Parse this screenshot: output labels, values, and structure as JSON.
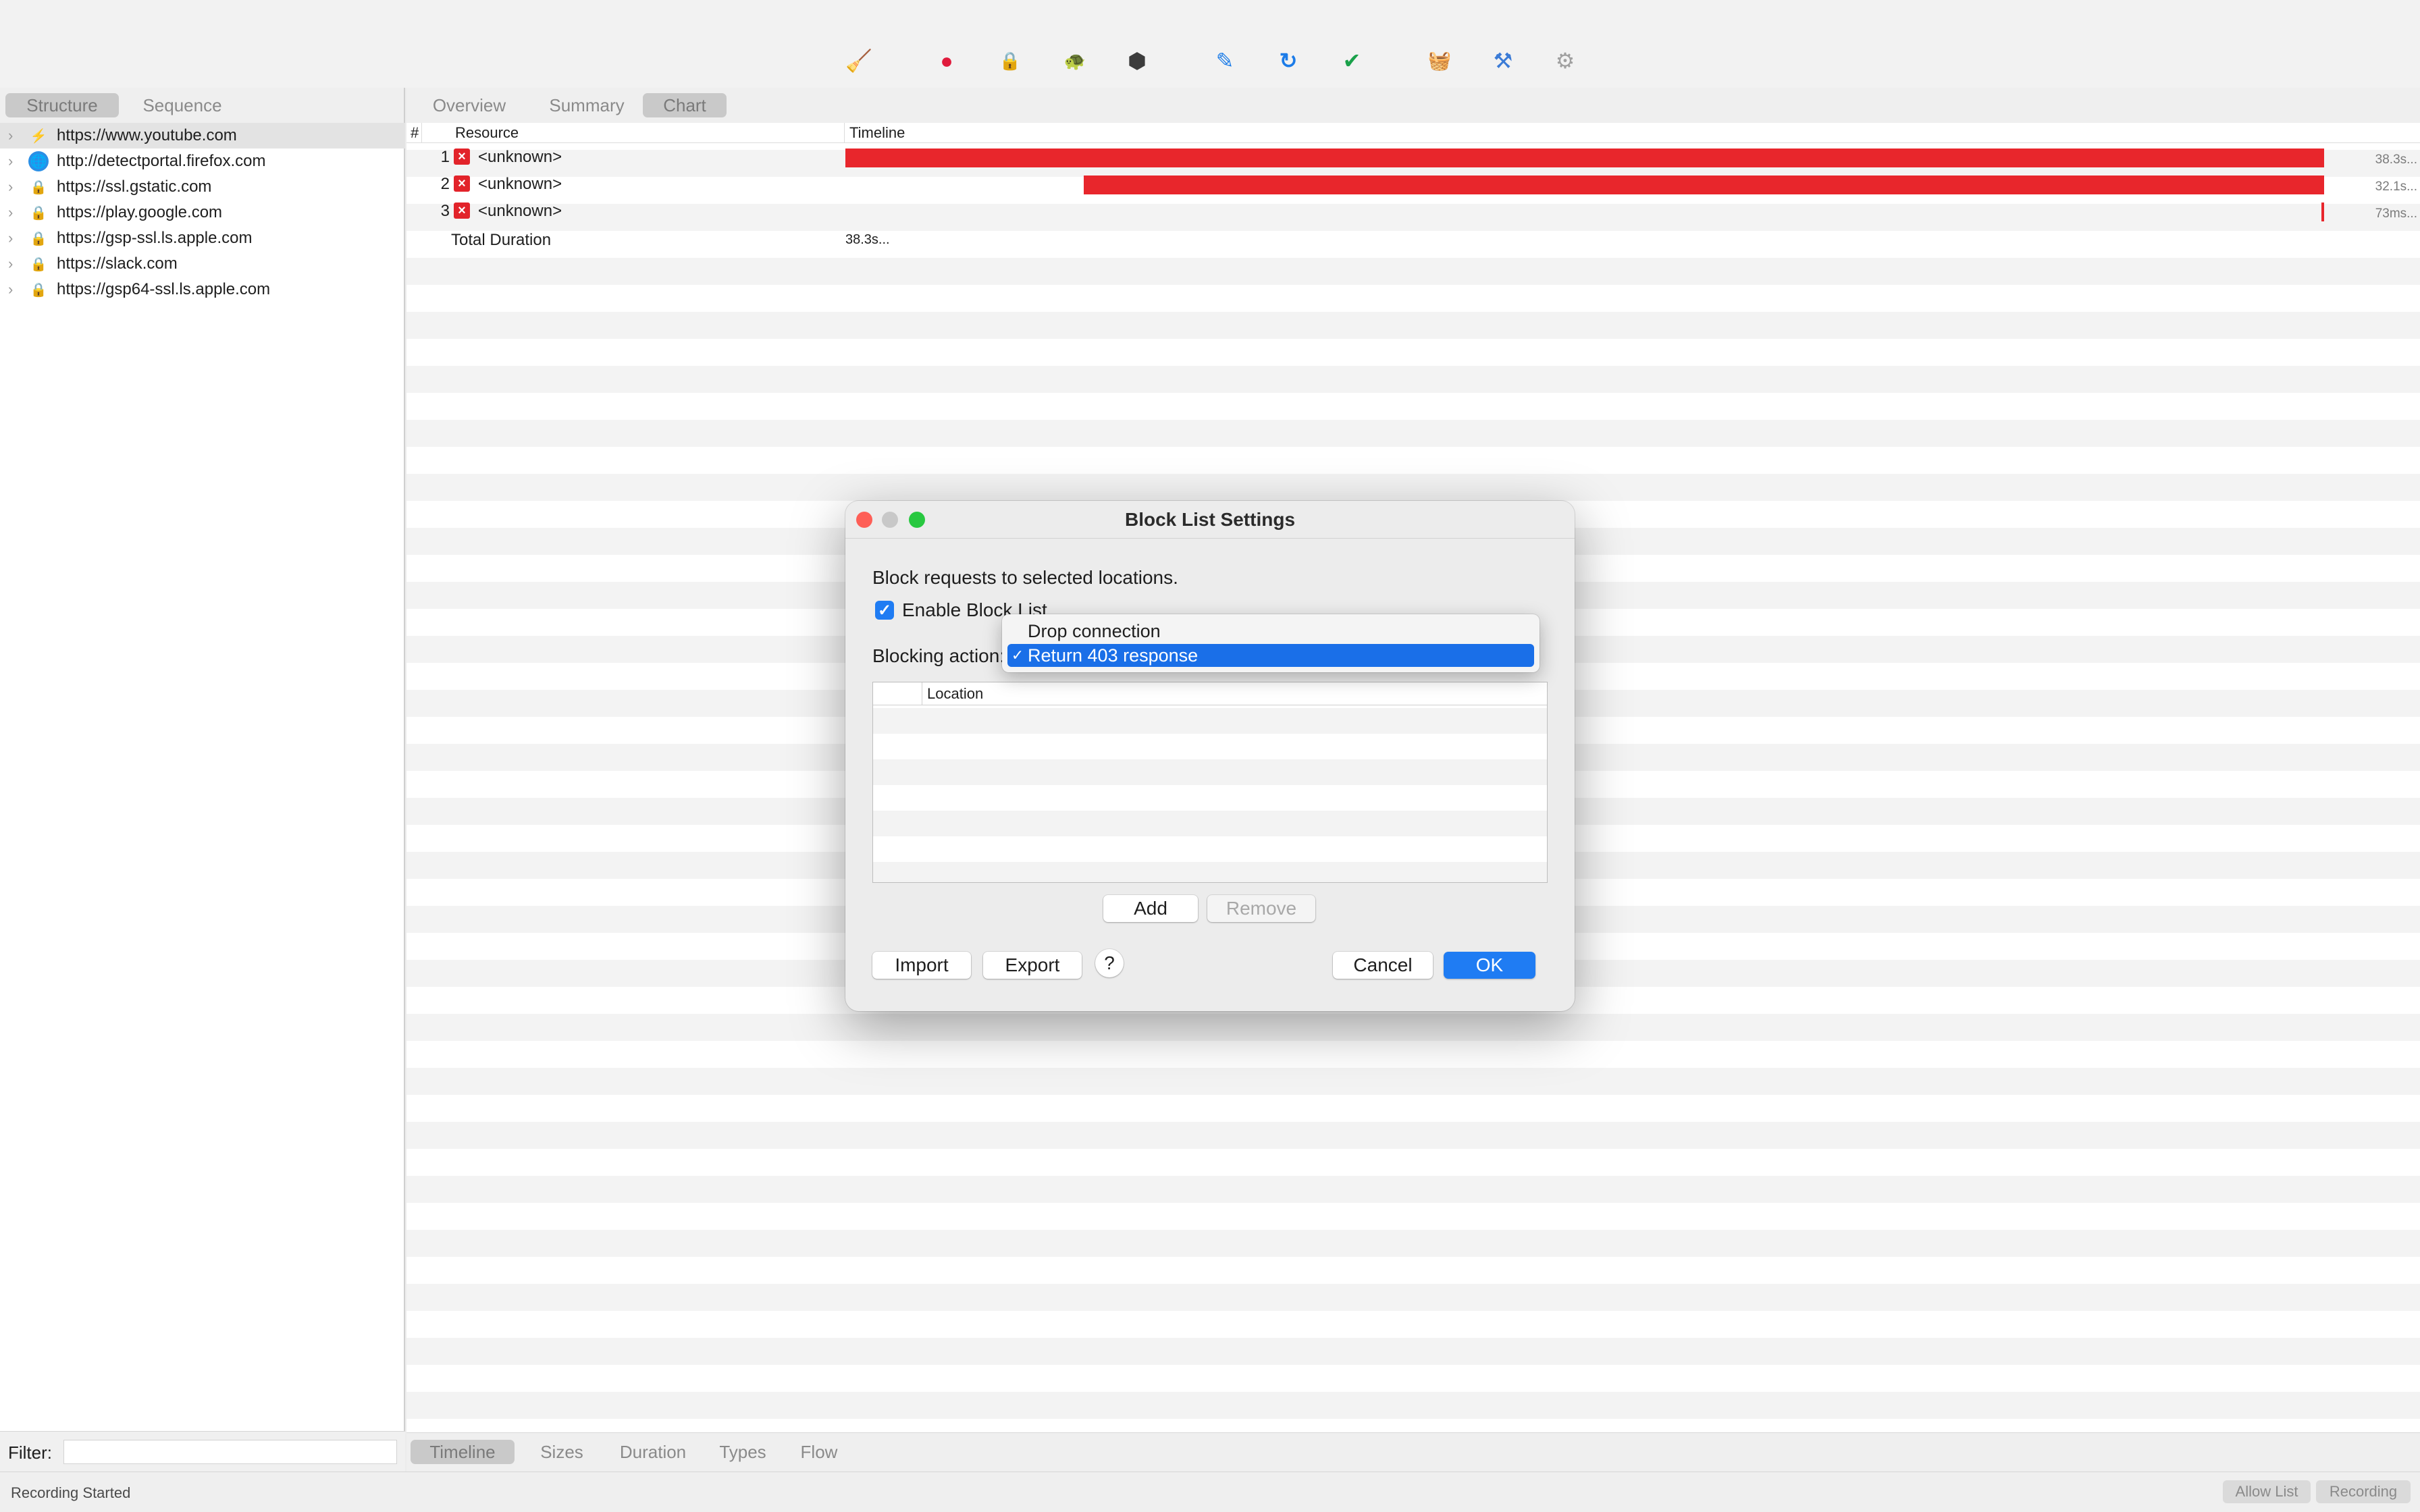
{
  "toolbar": {
    "icons": [
      {
        "name": "broom-icon",
        "glyph": "🧹",
        "color": "#e6a817"
      },
      {
        "name": "record-icon",
        "glyph": "●",
        "color": "#e01b3c"
      },
      {
        "name": "ssl-lock-icon",
        "glyph": "🔒",
        "color": "#888888"
      },
      {
        "name": "turtle-icon",
        "glyph": "🐢",
        "color": "#555555"
      },
      {
        "name": "stop-hexagon-icon",
        "glyph": "⬢",
        "color": "#3c3c3c"
      },
      {
        "name": "pen-icon",
        "glyph": "✎",
        "color": "#1c7ce8"
      },
      {
        "name": "refresh-icon",
        "glyph": "↻",
        "color": "#1c7ce8"
      },
      {
        "name": "checkmark-icon",
        "glyph": "✔",
        "color": "#1aa14a"
      },
      {
        "name": "basket-icon",
        "glyph": "🧺",
        "color": "#1aa14a"
      },
      {
        "name": "tools-icon",
        "glyph": "⚒",
        "color": "#3b7bd6"
      },
      {
        "name": "gear-icon",
        "glyph": "⚙",
        "color": "#a0a0a0"
      }
    ]
  },
  "left": {
    "tabs": [
      "Structure",
      "Sequence"
    ],
    "hosts": [
      {
        "url": "https://www.youtube.com",
        "icon": "lightning-icon"
      },
      {
        "url": "http://detectportal.firefox.com",
        "icon": "globe-icon"
      },
      {
        "url": "https://ssl.gstatic.com",
        "icon": "lock-icon"
      },
      {
        "url": "https://play.google.com",
        "icon": "lock-icon"
      },
      {
        "url": "https://gsp-ssl.ls.apple.com",
        "icon": "lock-icon"
      },
      {
        "url": "https://slack.com",
        "icon": "lock-icon"
      },
      {
        "url": "https://gsp64-ssl.ls.apple.com",
        "icon": "lock-icon"
      }
    ],
    "filter_label": "Filter:"
  },
  "right": {
    "tabs": [
      "Overview",
      "Summary",
      "Chart"
    ],
    "columns": {
      "num": "#",
      "resource": "Resource",
      "timeline": "Timeline"
    },
    "rows": [
      {
        "num": "1",
        "resource": "<unknown>",
        "duration": "38.3s...",
        "start_frac": 0.0,
        "end_frac": 1.0
      },
      {
        "num": "2",
        "resource": "<unknown>",
        "duration": "32.1s...",
        "start_frac": 0.161,
        "end_frac": 1.0
      },
      {
        "num": "3",
        "resource": "<unknown>",
        "duration": "73ms...",
        "start_frac": 0.998,
        "end_frac": 1.0
      }
    ],
    "total_label": "Total Duration",
    "total_value": "38.3s...",
    "bottom_tabs": [
      "Timeline",
      "Sizes",
      "Duration",
      "Types",
      "Flow"
    ]
  },
  "status": {
    "text": "Recording Started",
    "allow_list": "Allow List",
    "recording": "Recording"
  },
  "dialog": {
    "title": "Block List Settings",
    "description": "Block requests to selected locations.",
    "enable_label": "Enable Block List",
    "enable_checked": true,
    "blocking_label": "Blocking action:",
    "location_header": "Location",
    "add": "Add",
    "remove": "Remove",
    "import": "Import",
    "export": "Export",
    "help": "?",
    "cancel": "Cancel",
    "ok": "OK"
  },
  "popup": {
    "options": [
      "Drop connection",
      "Return 403 response"
    ],
    "selected_index": 1,
    "check_mark": "✓"
  },
  "colors": {
    "accent": "#1f7cf3",
    "timeline_bar": "#e8262c",
    "close": "#fe5f57",
    "minimize": "#c8c8c8",
    "zoom": "#28c840"
  }
}
